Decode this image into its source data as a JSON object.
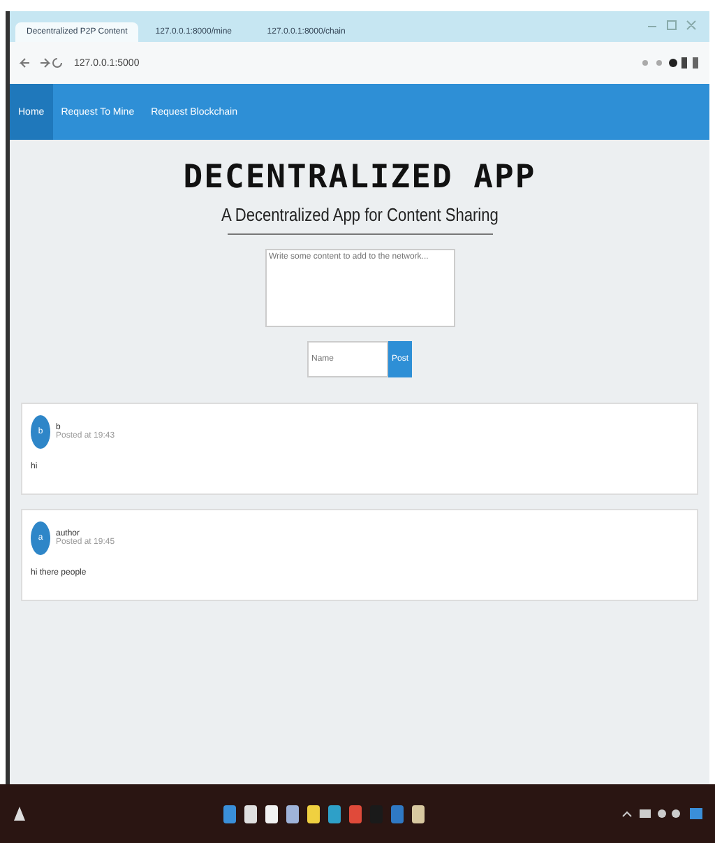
{
  "browser": {
    "tabs": [
      {
        "title": "Decentralized P2P Content",
        "selected": true
      },
      {
        "title": "127.0.0.1:8000/mine",
        "selected": false
      },
      {
        "title": "127.0.0.1:8000/chain",
        "selected": false
      }
    ],
    "address": "127.0.0.1:5000"
  },
  "nav": [
    {
      "label": "Home",
      "selected": true
    },
    {
      "label": "Request To Mine",
      "selected": false
    },
    {
      "label": "Request Blockchain",
      "selected": false
    }
  ],
  "header": {
    "title": "DECENTRALIZED APP",
    "subtitle": "A Decentralized App for Content Sharing"
  },
  "form": {
    "content_placeholder": "Write some content to add to the network...",
    "name_placeholder": "Name",
    "submit": "Post"
  },
  "posts": [
    {
      "avatar": "b",
      "author": "b",
      "time": "Posted at 19:43",
      "content": "hi"
    },
    {
      "avatar": "a",
      "author": "author",
      "time": "Posted at 19:45",
      "content": "hi there people"
    }
  ],
  "taskbar": {
    "apps": [
      {
        "color": "#3a8fd9"
      },
      {
        "color": "#e0e0e0"
      },
      {
        "color": "#f2f2f2"
      },
      {
        "color": "#9fb3d9"
      },
      {
        "color": "#f0d040"
      },
      {
        "color": "#2ea0c8"
      },
      {
        "color": "#e04a3a"
      },
      {
        "color": "#1a1a1a"
      },
      {
        "color": "#2f79c4"
      },
      {
        "color": "#d8c8a0"
      }
    ]
  }
}
